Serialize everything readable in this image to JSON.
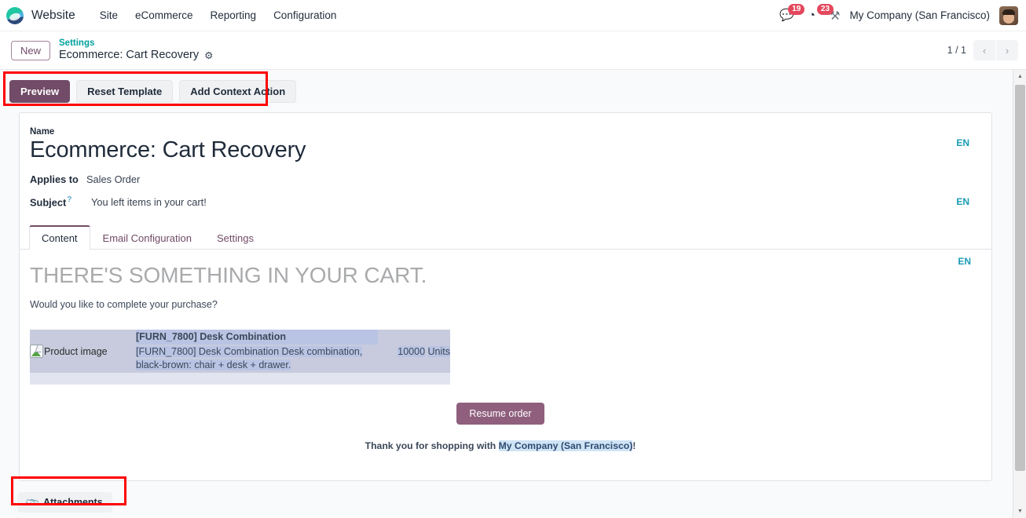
{
  "navbar": {
    "logo_icon": "website-app-logo",
    "brand": "Website",
    "menus": [
      "Site",
      "eCommerce",
      "Reporting",
      "Configuration"
    ],
    "messages": {
      "icon": "chat-bubble-icon",
      "glyph": "💬",
      "count": "19"
    },
    "activities": {
      "icon": "clock-icon",
      "glyph": "◔",
      "count": "23"
    },
    "tools": {
      "icon": "wrench-icon",
      "glyph": "⚒"
    },
    "company": "My Company (San Francisco)",
    "avatar_name": "user-avatar"
  },
  "control_panel": {
    "new_label": "New",
    "breadcrumb_parent": "Settings",
    "breadcrumb_current": "Ecommerce: Cart Recovery",
    "gear_glyph": "⚙",
    "pager_text": "1 / 1",
    "prev_glyph": "‹",
    "next_glyph": "›"
  },
  "statusbar": {
    "preview": "Preview",
    "reset_template": "Reset Template",
    "add_context_action": "Add Context Action"
  },
  "form": {
    "name_label": "Name",
    "name_value": "Ecommerce: Cart Recovery",
    "lang_badge": "EN",
    "applies_to_label": "Applies to",
    "applies_to_value": "Sales Order",
    "subject_label": "Subject",
    "subject_help": "?",
    "subject_value": "You left items in your cart!"
  },
  "notebook": {
    "tabs": [
      {
        "label": "Content",
        "active": true
      },
      {
        "label": "Email Configuration",
        "active": false
      },
      {
        "label": "Settings",
        "active": false
      }
    ]
  },
  "mail": {
    "lang_badge": "EN",
    "headline": "THERE'S SOMETHING IN YOUR CART.",
    "subline": "Would you like to complete your purchase?",
    "product": {
      "image_alt": "Product image",
      "name": "[FURN_7800] Desk Combination",
      "description": "[FURN_7800] Desk Combination Desk combination, black-brown: chair + desk + drawer.",
      "quantity": "10000",
      "unit": "Units"
    },
    "cta_label": "Resume order",
    "footer_prefix": "Thank you for shopping with ",
    "footer_company": "My Company (San Francisco)",
    "footer_suffix": "!"
  },
  "attachments": {
    "icon": "paperclip-icon",
    "glyph": "📎",
    "label": "Attachments"
  },
  "scrollbar": {
    "up_glyph": "▲",
    "down_glyph": "▼"
  },
  "colors": {
    "accent_purple": "#714b67",
    "teal_link": "#00a09d",
    "lang_badge": "#1a9bb5",
    "badge_red": "#e4485d",
    "annotation_red": "#ff0000"
  }
}
